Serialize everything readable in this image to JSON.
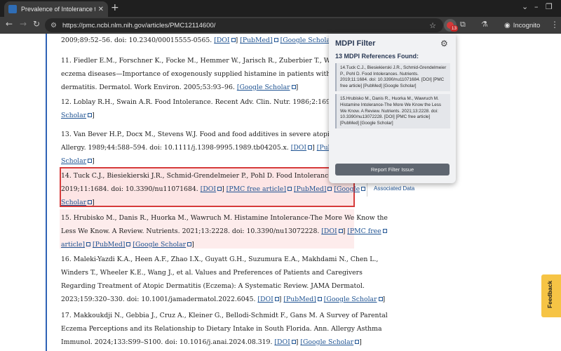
{
  "browser": {
    "tab_title": "Prevalence of Intolerance to Ad…",
    "tab_close": "✕",
    "new_tab": "+",
    "url": "https://pmc.ncbi.nlm.nih.gov/articles/PMC12114600/",
    "extension_badge": "13",
    "incognito_label": "Incognito"
  },
  "article": {
    "refs": [
      {
        "id": "ref-10-tail",
        "lines": [
          [
            {
              "t": "2009;89:52–56. doi: 10.2340/00015555-0565. "
            },
            {
              "link": "[DOI"
            },
            {
              "t": "] "
            },
            {
              "link": "[PubMed]"
            },
            {
              "t": " "
            },
            {
              "link": "[Google Scholar"
            },
            {
              "t": "]"
            }
          ]
        ]
      },
      {
        "id": "ref-11",
        "lines": [
          [
            {
              "t": "11. Fiedler E.M., Forschner K., Focke M., Hemmer W., Jarisch R., Zuberbier T., Worm M. Nutri"
            }
          ],
          [
            {
              "t": "eczema diseases—Importance of exogenously supplied histamine in patients with atopic"
            }
          ],
          [
            {
              "t": "dermatitis. Dermatol. Work Environ. 2005;53:93–96. "
            },
            {
              "link": "[Google Scholar"
            },
            {
              "t": "]"
            }
          ]
        ]
      },
      {
        "id": "ref-12",
        "lines": [
          [
            {
              "t": "12. Loblay R.H., Swain A.R. Food Intolerance. Recent Adv. Clin. Nutr. 1986;2:169–177. "
            },
            {
              "link": "[Goog"
            }
          ],
          [
            {
              "link": "Scholar"
            },
            {
              "t": "]"
            }
          ]
        ]
      },
      {
        "id": "ref-13",
        "lines": [
          [
            {
              "t": "13. Van Bever H.P., Docx M., Stevens W.J. Food and food additives in severe atopic dermatitis"
            }
          ],
          [
            {
              "t": "Allergy. 1989;44:588–594. doi: 10.1111/j.1398-9995.1989.tb04205.x. "
            },
            {
              "link": "[DOI"
            },
            {
              "t": "] "
            },
            {
              "link": "[PubMed]"
            },
            {
              "t": " "
            },
            {
              "link": "[G"
            }
          ],
          [
            {
              "link": "Scholar"
            },
            {
              "t": "]"
            }
          ]
        ]
      },
      {
        "id": "ref-14",
        "lines": [
          [
            {
              "t": "14. Tuck C.J., Biesiekierski J.R., Schmid-Grendelmeier P., Pohl D. Food Intolerances. Nutrien"
            }
          ],
          [
            {
              "t": "2019;11:1684. doi: 10.3390/nu11071684. "
            },
            {
              "link": "[DOI"
            },
            {
              "t": "] "
            },
            {
              "link": "[PMC free article]"
            },
            {
              "t": " "
            },
            {
              "link": "[PubMed]"
            },
            {
              "t": " "
            },
            {
              "link": "[Google"
            }
          ],
          [
            {
              "link": "Scholar"
            },
            {
              "t": "]"
            }
          ]
        ]
      },
      {
        "id": "ref-15",
        "lines": [
          [
            {
              "t": "15. Hrubisko M., Danis R., Huorka M., Wawruch M. Histamine Intolerance-The More We Know the"
            }
          ],
          [
            {
              "t": "Less We Know. A Review. Nutrients. 2021;13:2228. doi: 10.3390/nu13072228. "
            },
            {
              "link": "[DOI"
            },
            {
              "t": "] "
            },
            {
              "link": "[PMC free"
            }
          ],
          [
            {
              "link": "article]"
            },
            {
              "t": " "
            },
            {
              "link": "[PubMed]"
            },
            {
              "t": " "
            },
            {
              "link": "[Google Scholar"
            },
            {
              "t": "]"
            }
          ]
        ]
      },
      {
        "id": "ref-16",
        "lines": [
          [
            {
              "t": "16. Maleki-Yazdi K.A., Heen A.F., Zhao I.X., Guyatt G.H., Suzumura E.A., Makhdami N., Chen L.,"
            }
          ],
          [
            {
              "t": "Winders T., Wheeler K.E., Wang J., et al. Values and Preferences of Patients and Caregivers"
            }
          ],
          [
            {
              "t": "Regarding Treatment of Atopic Dermatitis (Eczema): A Systematic Review. JAMA Dermatol."
            }
          ],
          [
            {
              "t": "2023;159:320–330. doi: 10.1001/jamadermatol.2022.6045. "
            },
            {
              "link": "[DOI"
            },
            {
              "t": "] "
            },
            {
              "link": "[PubMed]"
            },
            {
              "t": " "
            },
            {
              "link": "[Google Scholar"
            },
            {
              "t": "]"
            }
          ]
        ]
      },
      {
        "id": "ref-17",
        "lines": [
          [
            {
              "t": "17. Makkoukdji N., Gebbia J., Cruz A., Kleiner G., Bellodi-Schmidt F., Gans M. A Survey of Parental"
            }
          ],
          [
            {
              "t": "Eczema Perceptions and its Relationship to Dietary Intake in South Florida. Ann. Allergy Asthma"
            }
          ],
          [
            {
              "t": "Immunol. 2024;133:S99–S100. doi: 10.1016/j.anai.2024.08.319. "
            },
            {
              "link": "[DOI"
            },
            {
              "t": "] "
            },
            {
              "link": "[Google Scholar"
            },
            {
              "t": "]"
            }
          ]
        ]
      }
    ],
    "side_link": "Associated Data"
  },
  "popup": {
    "title": "MDPI Filter",
    "count_label": "13 MDPI References Found:",
    "items": [
      "14.Tuck C.J., Biesiekierski J.R., Schmid-Grendelmeier P., Pohl D. Food Intolerances. Nutrients. 2019;11:1684. doi: 10.3390/nu11071684. [DOI] [PMC free article] [PubMed] [Google Scholar]",
      "15.Hrubisko M., Danis R., Huorka M., Wawruch M. Histamine Intolerance-The More We Know the Less We Know. A Review. Nutrients. 2021;13:2228. doi: 10.3390/nu13072228. [DOI] [PMC free article] [PubMed] [Google Scholar]"
    ],
    "report_button": "Report Filter Issue"
  },
  "feedback_label": "Feedback",
  "colors": {
    "link": "#205493",
    "highlight_border": "#d63b3b",
    "highlight_fill": "#fde5e5",
    "accent_rule": "#2e62b5",
    "feedback_tab": "#f6c445"
  }
}
